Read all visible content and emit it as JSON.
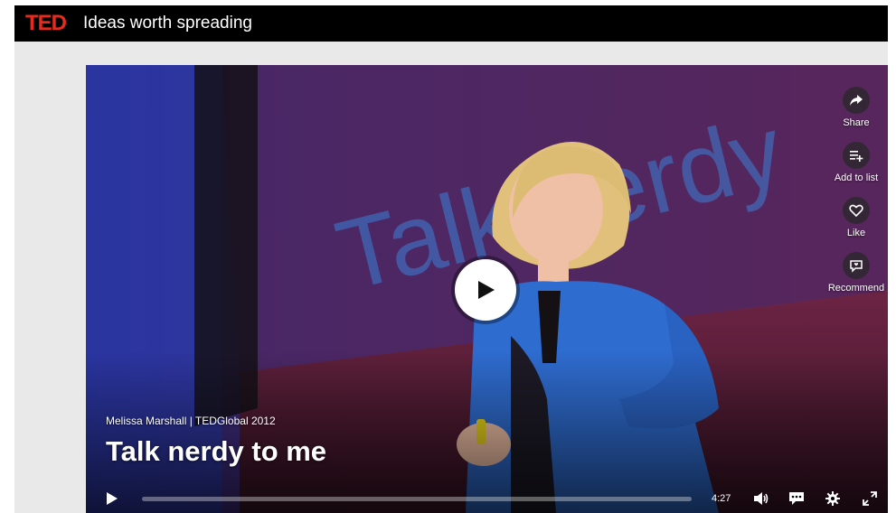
{
  "header": {
    "logo_text": "TED",
    "tagline": "Ideas worth spreading",
    "logo_color": "#e62b1e",
    "bar_color": "#000000"
  },
  "video": {
    "speaker_event": "Melissa Marshall | TEDGlobal 2012",
    "title": "Talk nerdy to me",
    "background_slide_text": "Talk nerdy",
    "duration": "4:27",
    "progress_fraction": 0.0
  },
  "actions": [
    {
      "label": "Share",
      "icon": "share-icon"
    },
    {
      "label": "Add to list",
      "icon": "playlist-add-icon"
    },
    {
      "label": "Like",
      "icon": "heart-icon"
    },
    {
      "label": "Recommend",
      "icon": "recommend-icon"
    }
  ],
  "controls": {
    "play_icon": "play-icon",
    "volume_icon": "volume-icon",
    "subtitles_icon": "subtitles-icon",
    "settings_icon": "gear-icon",
    "fullscreen_icon": "fullscreen-icon"
  }
}
